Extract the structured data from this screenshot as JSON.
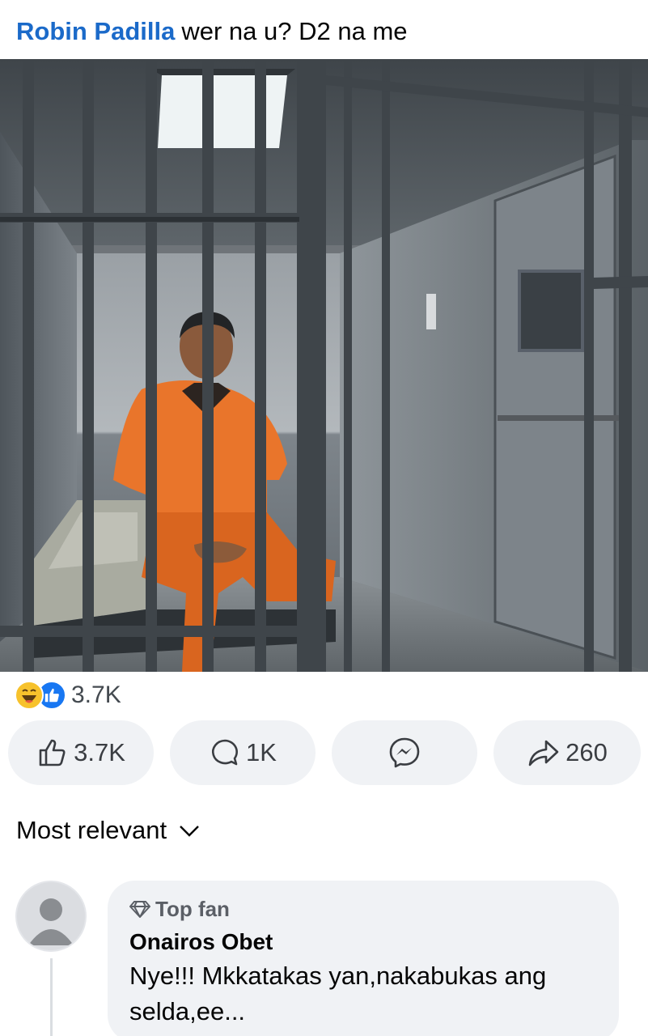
{
  "post": {
    "author": "Robin Padilla",
    "caption": "wer  na u? D2 na me"
  },
  "reactions": {
    "types": [
      "haha-emoji",
      "like-emoji"
    ],
    "count": "3.7K"
  },
  "actions": {
    "like_count": "3.7K",
    "comment_count": "1K",
    "share_count": "260"
  },
  "comments": {
    "sort_label": "Most relevant",
    "items": [
      {
        "badge": "Top fan",
        "name": "Onairos Obet",
        "text": "Nye!!! Mkkatakas yan,nakabukas ang selda,ee..."
      }
    ]
  },
  "colors": {
    "author": "#1b6ac9",
    "button_bg": "#f0f2f5",
    "like_blue": "#1877f2",
    "haha_yellow": "#f7c22c",
    "jumpsuit_orange": "#e9752b"
  }
}
